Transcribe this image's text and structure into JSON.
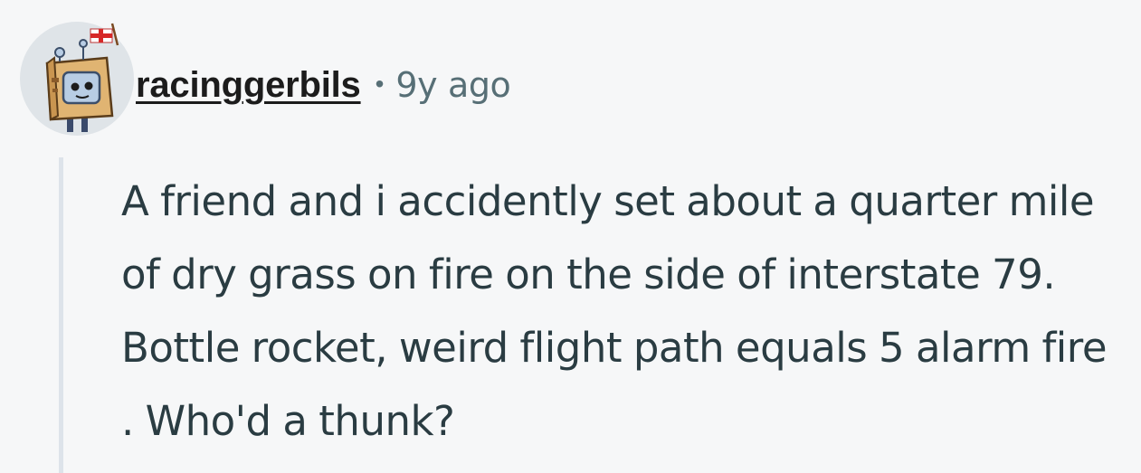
{
  "comment": {
    "author": "racinggerbils",
    "separator": "•",
    "timestamp": "9y ago",
    "body": "A friend and i accidently set about a quarter mile of dry grass on fire on the side of interstate 79. Bottle rocket, weird flight path equals 5 alarm fire . Who'd a thunk?",
    "avatar_icon": "robot-box-avatar-icon",
    "flag_icon": "england-flag-icon"
  },
  "colors": {
    "background": "#f6f7f8",
    "username": "#1c1c1c",
    "meta": "#576f76",
    "body_text": "#2a3c42",
    "thread_line": "#dde3ea"
  }
}
